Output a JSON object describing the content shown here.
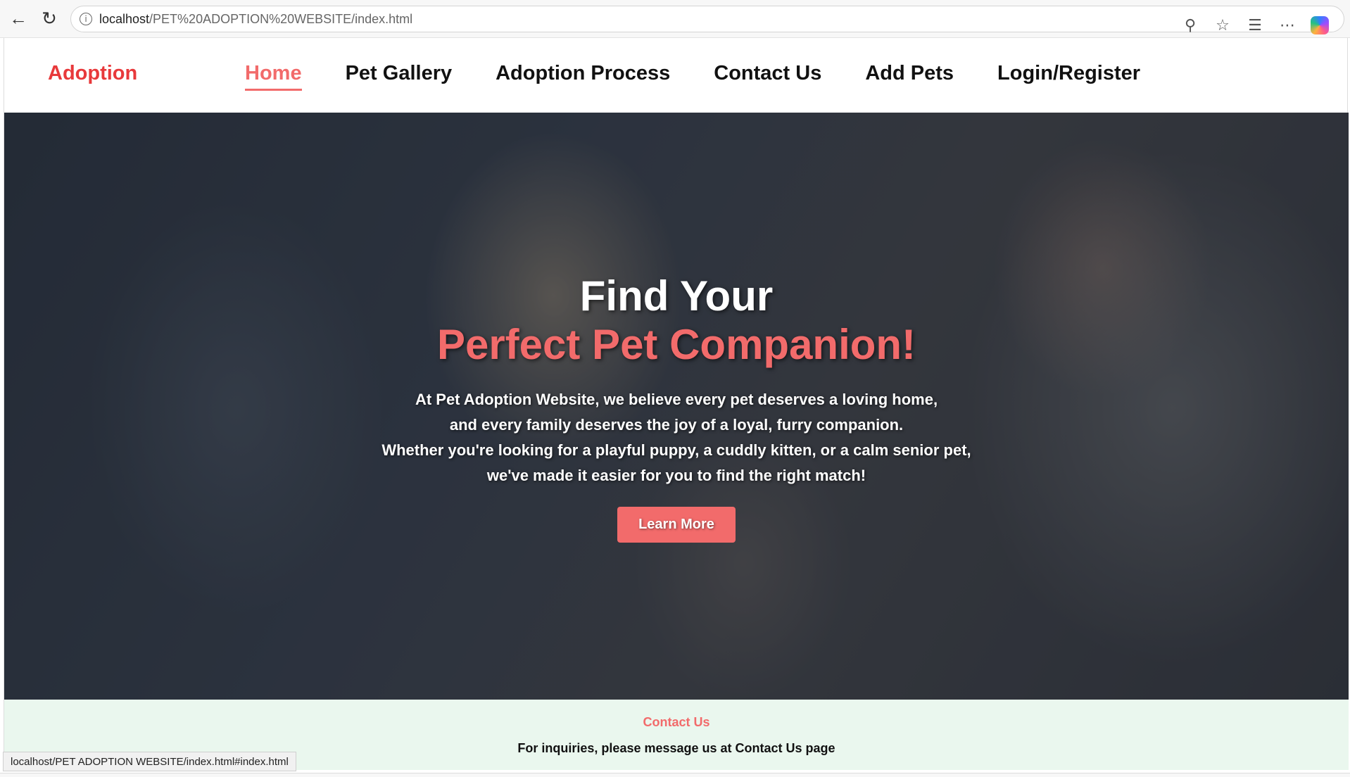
{
  "browser": {
    "url_host": "localhost",
    "url_path": "/PET%20ADOPTION%20WEBSITE/index.html",
    "status_url": "localhost/PET ADOPTION WEBSITE/index.html#index.html"
  },
  "header": {
    "brand": "Adoption",
    "menu": [
      {
        "label": "Home",
        "active": true
      },
      {
        "label": "Pet Gallery"
      },
      {
        "label": "Adoption Process"
      },
      {
        "label": "Contact Us"
      },
      {
        "label": "Add Pets"
      },
      {
        "label": "Login/Register"
      }
    ]
  },
  "hero": {
    "title_line1": "Find Your",
    "title_line2": "Perfect Pet Companion!",
    "text_lines": [
      "At Pet Adoption Website, we believe every pet deserves a loving home,",
      "and every family deserves the joy of a loyal, furry companion.",
      "Whether you're looking for a playful puppy, a cuddly kitten, or a calm senior pet,",
      "we've made it easier for you to find the right match!"
    ],
    "button": "Learn More"
  },
  "contact": {
    "title": "Contact Us",
    "text": "For inquiries, please message us at Contact Us page"
  },
  "colors": {
    "accent": "#f26b6b",
    "brand": "#e8393b",
    "footer_bg": "#eaf7ee"
  }
}
